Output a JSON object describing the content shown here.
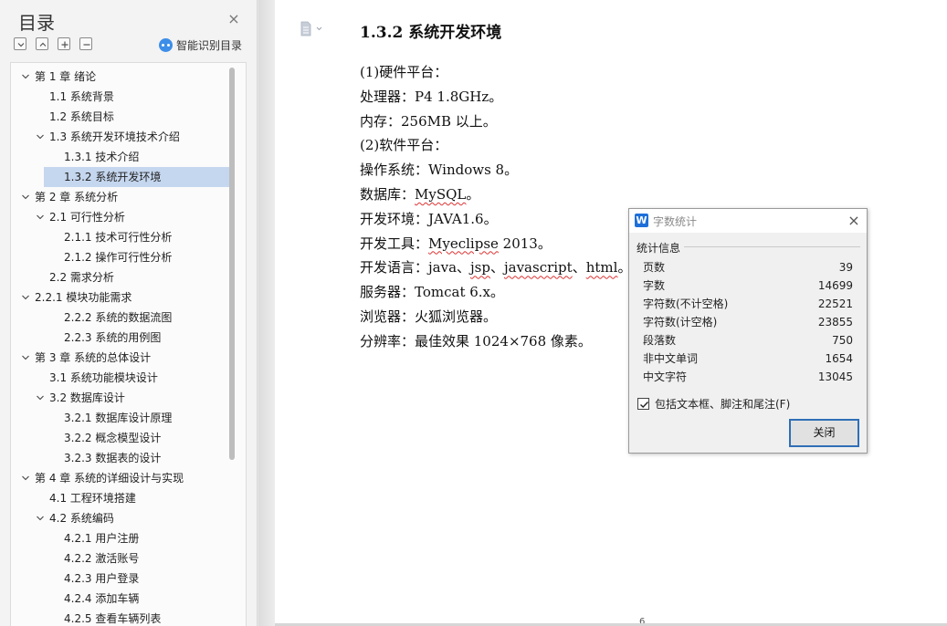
{
  "toc": {
    "title": "目录",
    "close_glyph": "×",
    "smart_label": "智能识别目录",
    "items": [
      {
        "label": "第 1 章  绪论",
        "level": 0,
        "expanded": true
      },
      {
        "label": "1.1 系统背景",
        "level": 1
      },
      {
        "label": "1.2 系统目标",
        "level": 1
      },
      {
        "label": "1.3 系统开发环境技术介绍",
        "level": 1,
        "expanded": true
      },
      {
        "label": "1.3.1 技术介绍",
        "level": 2
      },
      {
        "label": "1.3.2 系统开发环境",
        "level": 2,
        "selected": true
      },
      {
        "label": "第 2 章  系统分析",
        "level": 0,
        "expanded": true
      },
      {
        "label": "2.1 可行性分析",
        "level": 1,
        "expanded": true
      },
      {
        "label": "2.1.1 技术可行性分析",
        "level": 2
      },
      {
        "label": "2.1.2 操作可行性分析",
        "level": 2
      },
      {
        "label": "2.2 需求分析",
        "level": 1
      },
      {
        "label": "2.2.1 模块功能需求",
        "level": 0,
        "expanded": true
      },
      {
        "label": "2.2.2  系统的数据流图",
        "level": 2
      },
      {
        "label": "2.2.3  系统的用例图",
        "level": 2
      },
      {
        "label": "第 3 章  系统的总体设计",
        "level": 0,
        "expanded": true
      },
      {
        "label": "3.1  系统功能模块设计",
        "level": 1
      },
      {
        "label": "3.2 数据库设计",
        "level": 1,
        "expanded": true
      },
      {
        "label": "3.2.1 数据库设计原理",
        "level": 2
      },
      {
        "label": "3.2.2  概念模型设计",
        "level": 2
      },
      {
        "label": "3.2.3  数据表的设计",
        "level": 2
      },
      {
        "label": "第 4 章  系统的详细设计与实现",
        "level": 0,
        "expanded": true
      },
      {
        "label": "4.1  工程环境搭建",
        "level": 1
      },
      {
        "label": "4.2    系统编码",
        "level": 1,
        "expanded": true
      },
      {
        "label": "4.2.1    用户注册",
        "level": 2
      },
      {
        "label": "4.2.2    激活账号",
        "level": 2
      },
      {
        "label": "4.2.3    用户登录",
        "level": 2
      },
      {
        "label": "4.2.4    添加车辆",
        "level": 2
      },
      {
        "label": "4.2.5    查看车辆列表",
        "level": 2
      }
    ]
  },
  "document": {
    "heading": "1.3.2 系统开发环境",
    "lines": [
      {
        "segments": [
          {
            "text": "(1)硬件平台："
          }
        ]
      },
      {
        "segments": [
          {
            "text": "处理器：P4 1.8GHz。"
          }
        ]
      },
      {
        "segments": [
          {
            "text": "内存：256MB 以上。"
          }
        ]
      },
      {
        "segments": [
          {
            "text": "(2)软件平台："
          }
        ]
      },
      {
        "segments": [
          {
            "text": "操作系统：Windows 8。"
          }
        ]
      },
      {
        "segments": [
          {
            "text": "数据库："
          },
          {
            "text": "MySQL",
            "squiggle": true
          },
          {
            "text": "。"
          }
        ]
      },
      {
        "segments": [
          {
            "text": "开发环境：JAVA1.6。"
          }
        ]
      },
      {
        "segments": [
          {
            "text": "开发工具："
          },
          {
            "text": "Myeclipse",
            "squiggle": true
          },
          {
            "text": " 2013。"
          }
        ]
      },
      {
        "segments": [
          {
            "text": "开发语言：java、"
          },
          {
            "text": "jsp",
            "squiggle": true
          },
          {
            "text": "、"
          },
          {
            "text": "javascript",
            "squiggle": true
          },
          {
            "text": "、"
          },
          {
            "text": "html",
            "squiggle": true
          },
          {
            "text": "。"
          }
        ]
      },
      {
        "segments": [
          {
            "text": "服务器：Tomcat 6.x。"
          }
        ]
      },
      {
        "segments": [
          {
            "text": "浏览器：火狐浏览器。"
          }
        ]
      },
      {
        "segments": [
          {
            "text": "分辨率：最佳效果 1024×768 像素。"
          }
        ]
      }
    ],
    "page_number": "6"
  },
  "word_count_dialog": {
    "title": "字数统计",
    "app_icon_letter": "W",
    "close_glyph": "×",
    "group_label": "统计信息",
    "stats": [
      {
        "label": "页数",
        "value": "39"
      },
      {
        "label": "字数",
        "value": "14699"
      },
      {
        "label": "字符数(不计空格)",
        "value": "22521"
      },
      {
        "label": "字符数(计空格)",
        "value": "23855"
      },
      {
        "label": "段落数",
        "value": "750"
      },
      {
        "label": "非中文单词",
        "value": "1654"
      },
      {
        "label": "中文字符",
        "value": "13045"
      }
    ],
    "include_checkbox_label": "包括文本框、脚注和尾注(F)",
    "include_checked": true,
    "close_button_label": "关闭"
  }
}
